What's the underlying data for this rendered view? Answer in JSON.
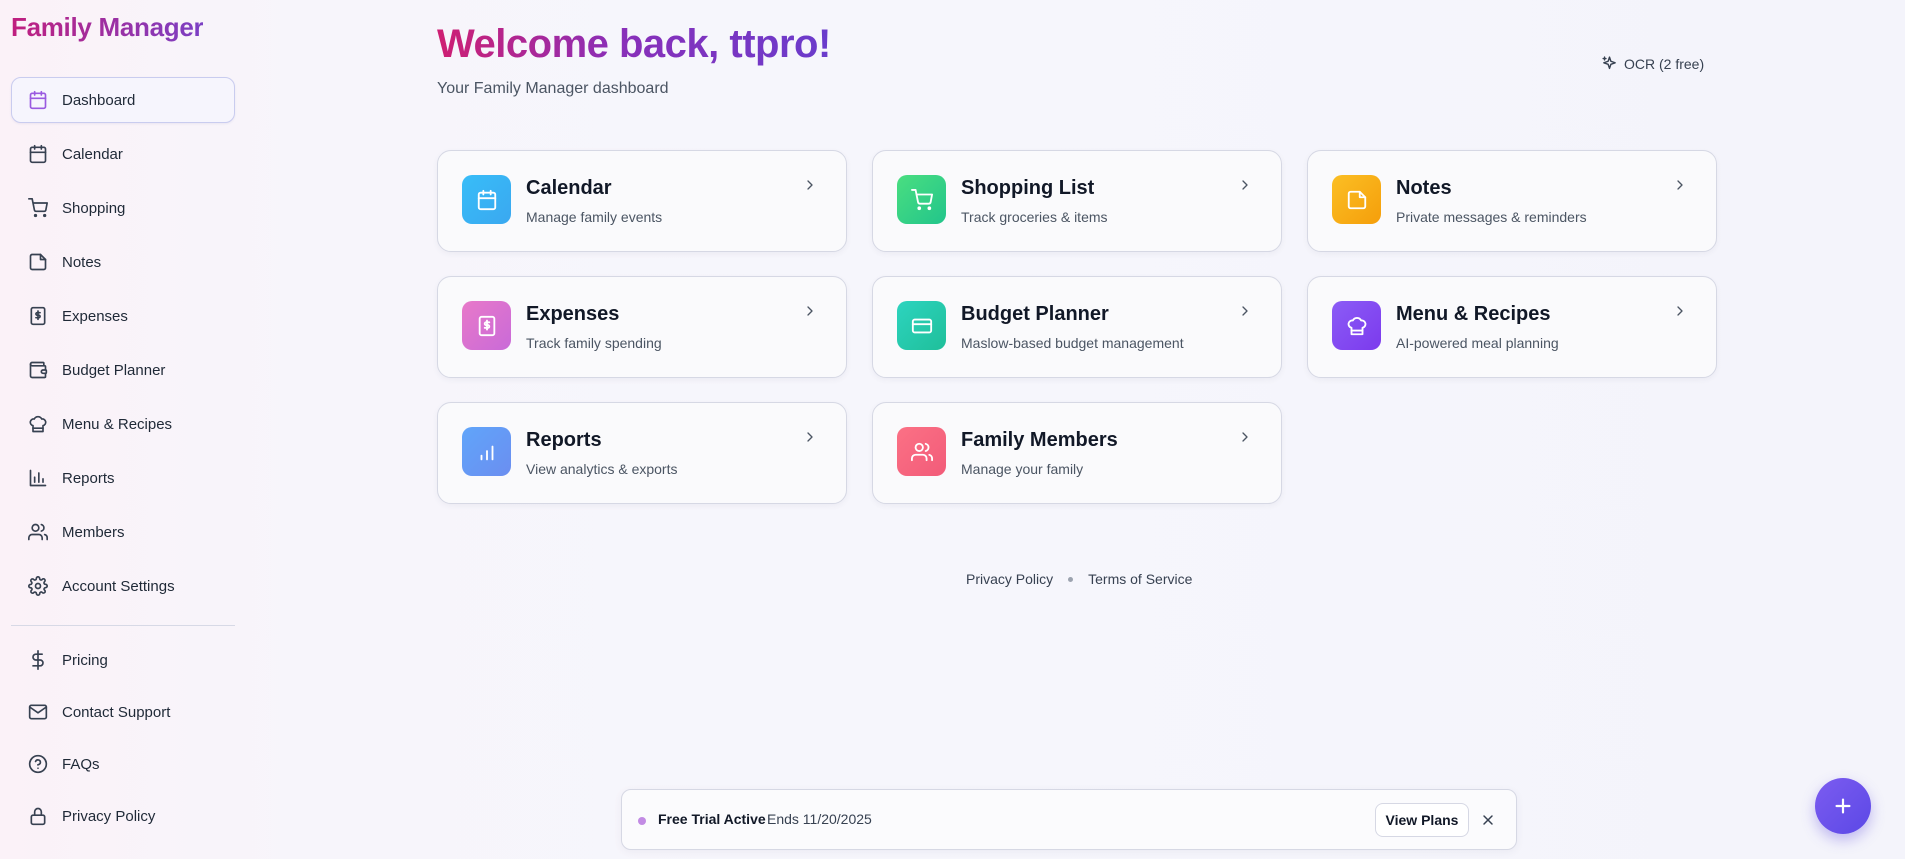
{
  "app": {
    "brand": "Family Manager"
  },
  "sidebar": {
    "items": [
      {
        "label": "Dashboard",
        "icon": "calendar-icon",
        "active": true
      },
      {
        "label": "Calendar",
        "icon": "calendar-icon"
      },
      {
        "label": "Shopping",
        "icon": "cart-icon"
      },
      {
        "label": "Notes",
        "icon": "note-icon"
      },
      {
        "label": "Expenses",
        "icon": "receipt-icon"
      },
      {
        "label": "Budget Planner",
        "icon": "wallet-icon"
      },
      {
        "label": "Menu & Recipes",
        "icon": "chef-hat-icon"
      },
      {
        "label": "Reports",
        "icon": "bar-chart-icon"
      },
      {
        "label": "Members",
        "icon": "users-icon"
      },
      {
        "label": "Account Settings",
        "icon": "gear-icon"
      }
    ],
    "secondary": [
      {
        "label": "Pricing",
        "icon": "dollar-icon"
      },
      {
        "label": "Contact Support",
        "icon": "mail-icon"
      },
      {
        "label": "FAQs",
        "icon": "help-circle-icon"
      },
      {
        "label": "Privacy Policy",
        "icon": "lock-icon"
      }
    ]
  },
  "header": {
    "welcome": "Welcome back, ttpro!",
    "subtitle": "Your Family Manager dashboard",
    "ocr_label": "OCR (2 free)"
  },
  "cards": [
    {
      "title": "Calendar",
      "desc": "Manage family events",
      "icon": "calendar-icon",
      "color": "#38bdf8"
    },
    {
      "title": "Shopping List",
      "desc": "Track groceries & items",
      "icon": "cart-icon",
      "color": "#34d399"
    },
    {
      "title": "Notes",
      "desc": "Private messages & reminders",
      "icon": "note-icon",
      "color": "#fbbf24"
    },
    {
      "title": "Expenses",
      "desc": "Track family spending",
      "icon": "receipt-icon",
      "color": "#e879c9"
    },
    {
      "title": "Budget Planner",
      "desc": "Maslow-based budget management",
      "icon": "card-icon",
      "color": "#2dd4bf"
    },
    {
      "title": "Menu & Recipes",
      "desc": "AI-powered meal planning",
      "icon": "chef-hat-icon",
      "color": "#8b5cf6"
    },
    {
      "title": "Reports",
      "desc": "View analytics & exports",
      "icon": "bar-chart-icon",
      "color": "#60a5fa"
    },
    {
      "title": "Family Members",
      "desc": "Manage your family",
      "icon": "users-icon",
      "color": "#fb7185"
    }
  ],
  "footer": {
    "privacy": "Privacy Policy",
    "terms": "Terms of Service"
  },
  "trial": {
    "label": "Free Trial Active",
    "ends": "Ends 11/20/2025",
    "button": "View Plans"
  }
}
